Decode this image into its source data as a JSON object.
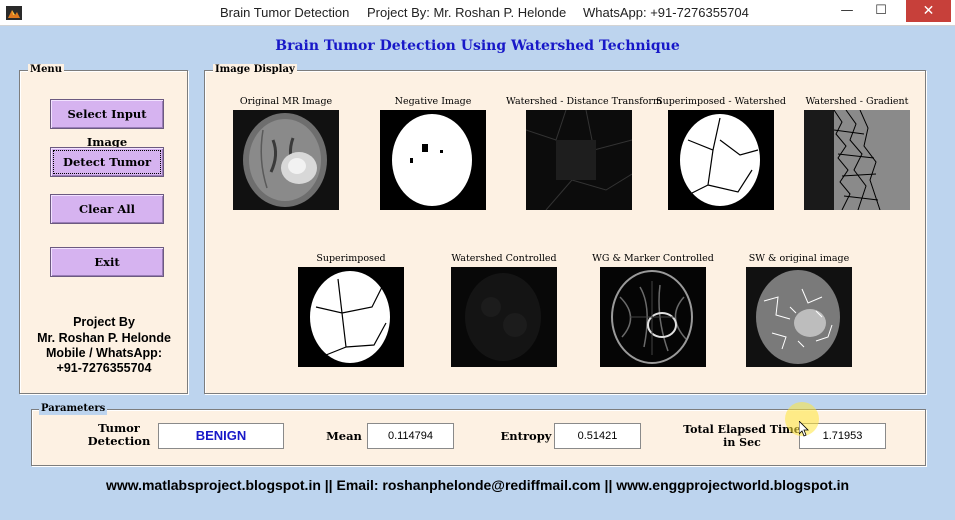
{
  "window": {
    "title": "Brain Tumor Detection",
    "project": "Project By: Mr. Roshan P. Helonde",
    "whatsapp": "WhatsApp: +91-7276355704",
    "controls": {
      "minimize": "—",
      "maximize": "☐",
      "close": "✕"
    }
  },
  "heading": "Brain Tumor Detection Using Watershed Technique",
  "menu": {
    "title": "Menu",
    "buttons": {
      "select": "Select Input Image",
      "detect": "Detect Tumor",
      "clear": "Clear All",
      "exit": "Exit"
    },
    "credit": {
      "line1": "Project By",
      "line2": "Mr. Roshan P. Helonde",
      "line3": "Mobile / WhatsApp:",
      "line4": "+91-7276355704"
    }
  },
  "image_display": {
    "title": "Image Display",
    "captions": {
      "original": "Original MR Image",
      "negative": "Negative Image",
      "distance": "Watershed - Distance Transform",
      "superimposed_ws": "Superimposed - Watershed",
      "gradient": "Watershed - Gradient",
      "superimposed": "Superimposed",
      "controlled": "Watershed Controlled",
      "marker": "WG & Marker Controlled",
      "sw_original": "SW & original image"
    }
  },
  "parameters": {
    "title": "Parameters",
    "tumor_label_1": "Tumor",
    "tumor_label_2": "Detection",
    "tumor_value": "BENIGN",
    "mean_label": "Mean",
    "mean_value": "0.114794",
    "entropy_label": "Entropy",
    "entropy_value": "0.51421",
    "time_label_1": "Total Elapsed Time",
    "time_label_2": "in Sec",
    "time_value": "1.71953"
  },
  "footer": "www.matlabsproject.blogspot.in ||  Email: roshanphelonde@rediffmail.com ||  www.enggprojectworld.blogspot.in",
  "colors": {
    "background": "#bdd4ee",
    "panel": "#fdf1e3",
    "button": "#d6b3f0",
    "heading": "#1818c8"
  }
}
